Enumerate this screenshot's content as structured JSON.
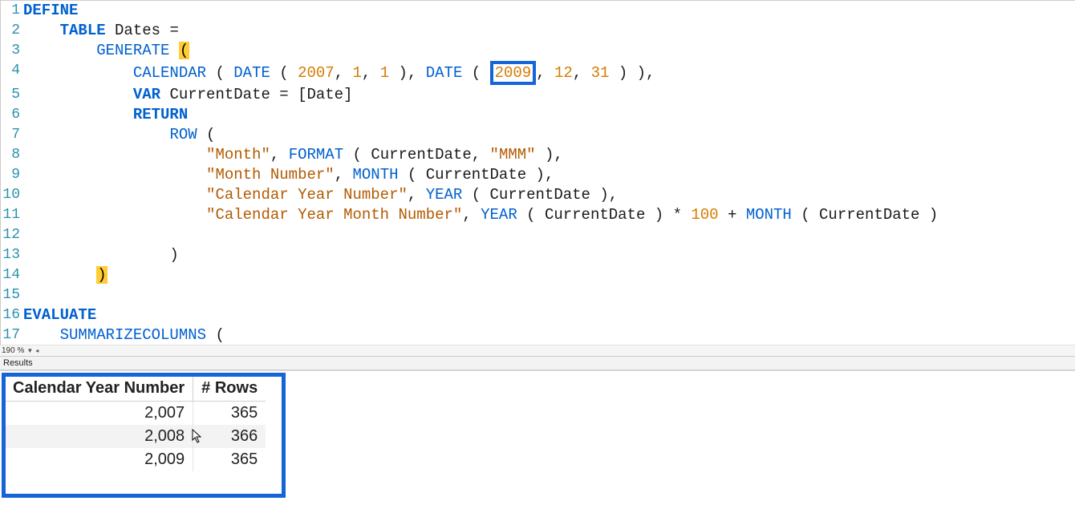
{
  "zoom": "190 %",
  "results_label": "Results",
  "code": {
    "lines": [
      {
        "n": "1",
        "tokens": [
          [
            "kw",
            "DEFINE"
          ]
        ]
      },
      {
        "n": "2",
        "tokens": [
          [
            "txt",
            "    "
          ],
          [
            "kw",
            "TABLE"
          ],
          [
            "txt",
            " Dates ="
          ]
        ]
      },
      {
        "n": "3",
        "tokens": [
          [
            "txt",
            "        "
          ],
          [
            "fn",
            "GENERATE"
          ],
          [
            "txt",
            " "
          ],
          [
            "hlparen",
            "("
          ]
        ]
      },
      {
        "n": "4",
        "tokens": [
          [
            "txt",
            "            "
          ],
          [
            "fn",
            "CALENDAR"
          ],
          [
            "txt",
            " ( "
          ],
          [
            "fn",
            "DATE"
          ],
          [
            "txt",
            " ( "
          ],
          [
            "num",
            "2007"
          ],
          [
            "txt",
            ", "
          ],
          [
            "num",
            "1"
          ],
          [
            "txt",
            ", "
          ],
          [
            "num",
            "1"
          ],
          [
            "txt",
            " ), "
          ],
          [
            "fn",
            "DATE"
          ],
          [
            "txt",
            " ( "
          ],
          [
            "boxnum",
            "2009"
          ],
          [
            "txt",
            ", "
          ],
          [
            "num",
            "12"
          ],
          [
            "txt",
            ", "
          ],
          [
            "num",
            "31"
          ],
          [
            "txt",
            " ) ),"
          ]
        ]
      },
      {
        "n": "5",
        "tokens": [
          [
            "txt",
            "            "
          ],
          [
            "kw",
            "VAR"
          ],
          [
            "txt",
            " CurrentDate = [Date]"
          ]
        ]
      },
      {
        "n": "6",
        "tokens": [
          [
            "txt",
            "            "
          ],
          [
            "kw",
            "RETURN"
          ]
        ]
      },
      {
        "n": "7",
        "tokens": [
          [
            "txt",
            "                "
          ],
          [
            "fn",
            "ROW"
          ],
          [
            "txt",
            " ("
          ]
        ]
      },
      {
        "n": "8",
        "tokens": [
          [
            "txt",
            "                    "
          ],
          [
            "str",
            "\"Month\""
          ],
          [
            "txt",
            ", "
          ],
          [
            "fn",
            "FORMAT"
          ],
          [
            "txt",
            " ( CurrentDate, "
          ],
          [
            "str",
            "\"MMM\""
          ],
          [
            "txt",
            " ),"
          ]
        ]
      },
      {
        "n": "9",
        "tokens": [
          [
            "txt",
            "                    "
          ],
          [
            "str",
            "\"Month Number\""
          ],
          [
            "txt",
            ", "
          ],
          [
            "fn",
            "MONTH"
          ],
          [
            "txt",
            " ( CurrentDate ),"
          ]
        ]
      },
      {
        "n": "10",
        "tokens": [
          [
            "txt",
            "                    "
          ],
          [
            "str",
            "\"Calendar Year Number\""
          ],
          [
            "txt",
            ", "
          ],
          [
            "fn",
            "YEAR"
          ],
          [
            "txt",
            " ( CurrentDate ),"
          ]
        ]
      },
      {
        "n": "11",
        "tokens": [
          [
            "txt",
            "                    "
          ],
          [
            "str",
            "\"Calendar Year Month Number\""
          ],
          [
            "txt",
            ", "
          ],
          [
            "fn",
            "YEAR"
          ],
          [
            "txt",
            " ( CurrentDate ) * "
          ],
          [
            "num",
            "100"
          ],
          [
            "txt",
            " + "
          ],
          [
            "fn",
            "MONTH"
          ],
          [
            "txt",
            " ( CurrentDate )"
          ]
        ]
      },
      {
        "n": "12",
        "tokens": []
      },
      {
        "n": "13",
        "tokens": [
          [
            "txt",
            "                )"
          ]
        ]
      },
      {
        "n": "14",
        "tokens": [
          [
            "txt",
            "        "
          ],
          [
            "hlparen",
            ")"
          ]
        ]
      },
      {
        "n": "15",
        "tokens": []
      },
      {
        "n": "16",
        "tokens": [
          [
            "kw",
            "EVALUATE"
          ]
        ]
      },
      {
        "n": "17",
        "tokens": [
          [
            "txt",
            "    "
          ],
          [
            "fn",
            "SUMMARIZECOLUMNS"
          ],
          [
            "txt",
            " ("
          ]
        ]
      }
    ]
  },
  "results": {
    "headers": [
      "Calendar Year Number",
      "# Rows"
    ],
    "rows": [
      [
        "2,007",
        "365"
      ],
      [
        "2,008",
        "366"
      ],
      [
        "2,009",
        "365"
      ]
    ]
  }
}
